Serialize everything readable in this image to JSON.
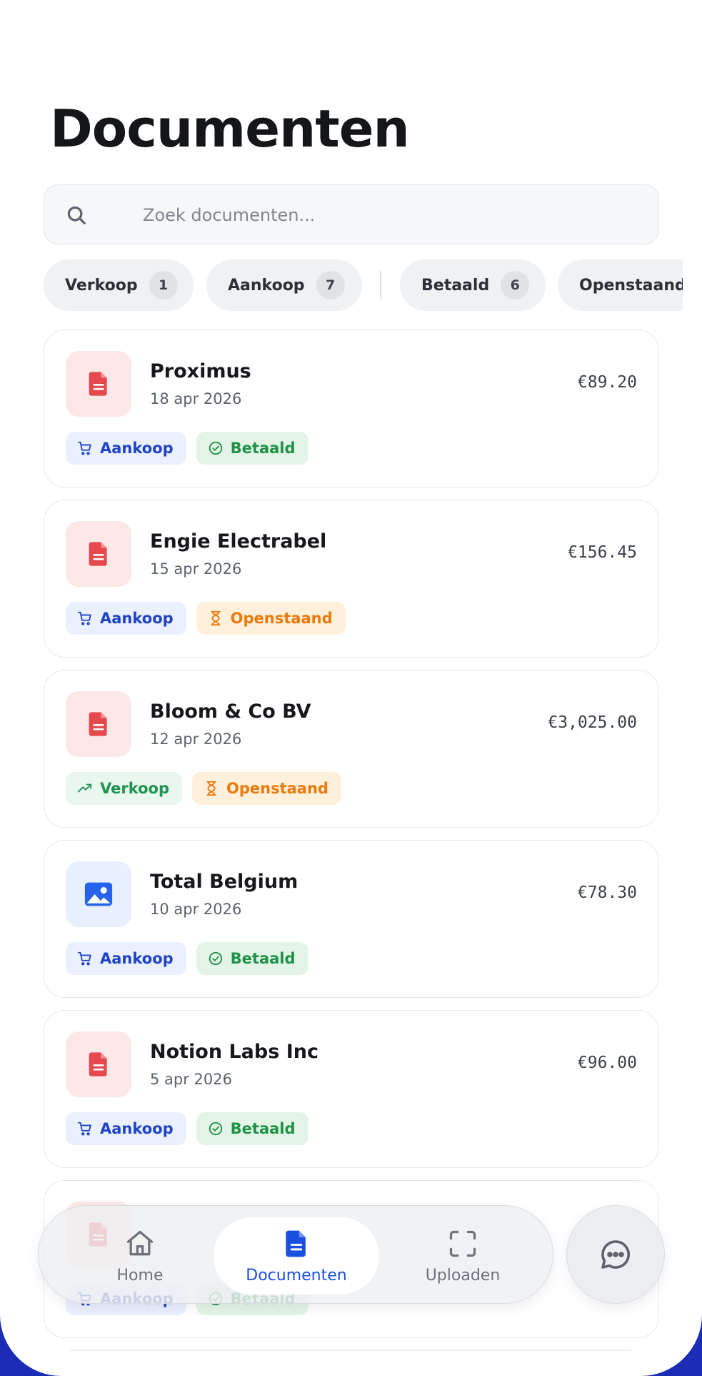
{
  "page": {
    "title": "Documenten"
  },
  "search": {
    "placeholder": "Zoek documenten..."
  },
  "filters": [
    {
      "label": "Verkoop",
      "count": "1"
    },
    {
      "label": "Aankoop",
      "count": "7"
    },
    {
      "label": "Betaald",
      "count": "6"
    },
    {
      "label": "Openstaand",
      "count": ""
    }
  ],
  "documents": [
    {
      "name": "Proximus",
      "date": "18 apr 2026",
      "amount": "€89.20",
      "file_icon": "pdf-document-icon",
      "type_label": "Aankoop",
      "type_icon": "cart-icon",
      "status_label": "Betaald",
      "status_icon": "check-circle-icon"
    },
    {
      "name": "Engie Electrabel",
      "date": "15 apr 2026",
      "amount": "€156.45",
      "file_icon": "pdf-document-icon",
      "type_label": "Aankoop",
      "type_icon": "cart-icon",
      "status_label": "Openstaand",
      "status_icon": "hourglass-icon"
    },
    {
      "name": "Bloom & Co BV",
      "date": "12 apr 2026",
      "amount": "€3,025.00",
      "file_icon": "pdf-document-icon",
      "type_label": "Verkoop",
      "type_icon": "trending-up-icon",
      "status_label": "Openstaand",
      "status_icon": "hourglass-icon"
    },
    {
      "name": "Total Belgium",
      "date": "10 apr 2026",
      "amount": "€78.30",
      "file_icon": "image-document-icon",
      "type_label": "Aankoop",
      "type_icon": "cart-icon",
      "status_label": "Betaald",
      "status_icon": "check-circle-icon"
    },
    {
      "name": "Notion Labs Inc",
      "date": "5 apr 2026",
      "amount": "€96.00",
      "file_icon": "pdf-document-icon",
      "type_label": "Aankoop",
      "type_icon": "cart-icon",
      "status_label": "Betaald",
      "status_icon": "check-circle-icon"
    },
    {
      "name": "",
      "date": "",
      "amount": "",
      "file_icon": "pdf-document-icon",
      "type_label": "Aankoop",
      "type_icon": "cart-icon",
      "status_label": "Betaald",
      "status_icon": "check-circle-icon"
    }
  ],
  "nav": {
    "items": [
      {
        "label": "Home",
        "icon": "home-icon"
      },
      {
        "label": "Documenten",
        "icon": "document-icon",
        "active": true
      },
      {
        "label": "Uploaden",
        "icon": "scan-icon"
      }
    ],
    "chat_icon": "chat-bubble-icon"
  },
  "colors": {
    "accent": "#1a4fe0",
    "purchase": "#1f43c7",
    "sale": "#1e9450",
    "paid": "#1e9146",
    "open": "#ea7a0c",
    "pdf": "#e5484d",
    "background_band": "#1a2db4"
  }
}
